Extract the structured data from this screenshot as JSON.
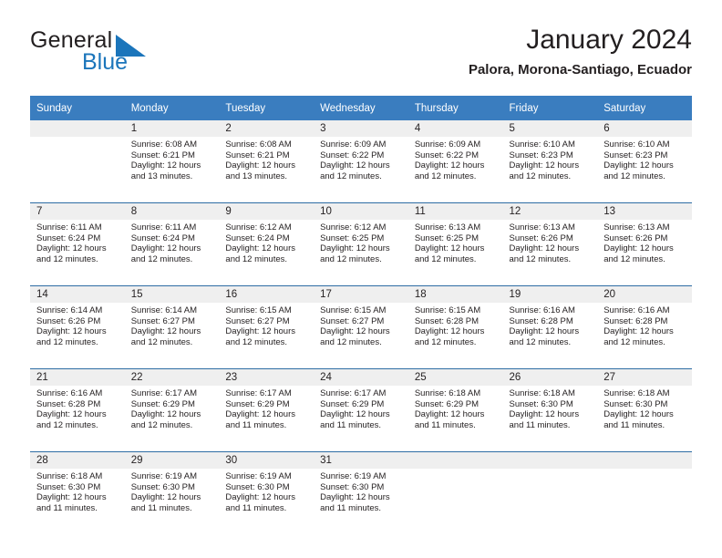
{
  "brand": {
    "name_part1": "General",
    "name_part2": "Blue",
    "accent_color": "#1b75bb",
    "triangle_icon": "logo-triangle-icon"
  },
  "header": {
    "month_title": "January 2024",
    "location": "Palora, Morona-Santiago, Ecuador"
  },
  "calendar": {
    "header_bg": "#3a7dbf",
    "row_divider_color": "#2e6da4",
    "daynum_band_bg": "#efefef",
    "weekday_headers": [
      "Sunday",
      "Monday",
      "Tuesday",
      "Wednesday",
      "Thursday",
      "Friday",
      "Saturday"
    ],
    "weeks": [
      [
        {
          "day": "",
          "sunrise": "",
          "sunset": "",
          "daylight1": "",
          "daylight2": ""
        },
        {
          "day": "1",
          "sunrise": "Sunrise: 6:08 AM",
          "sunset": "Sunset: 6:21 PM",
          "daylight1": "Daylight: 12 hours",
          "daylight2": "and 13 minutes."
        },
        {
          "day": "2",
          "sunrise": "Sunrise: 6:08 AM",
          "sunset": "Sunset: 6:21 PM",
          "daylight1": "Daylight: 12 hours",
          "daylight2": "and 13 minutes."
        },
        {
          "day": "3",
          "sunrise": "Sunrise: 6:09 AM",
          "sunset": "Sunset: 6:22 PM",
          "daylight1": "Daylight: 12 hours",
          "daylight2": "and 12 minutes."
        },
        {
          "day": "4",
          "sunrise": "Sunrise: 6:09 AM",
          "sunset": "Sunset: 6:22 PM",
          "daylight1": "Daylight: 12 hours",
          "daylight2": "and 12 minutes."
        },
        {
          "day": "5",
          "sunrise": "Sunrise: 6:10 AM",
          "sunset": "Sunset: 6:23 PM",
          "daylight1": "Daylight: 12 hours",
          "daylight2": "and 12 minutes."
        },
        {
          "day": "6",
          "sunrise": "Sunrise: 6:10 AM",
          "sunset": "Sunset: 6:23 PM",
          "daylight1": "Daylight: 12 hours",
          "daylight2": "and 12 minutes."
        }
      ],
      [
        {
          "day": "7",
          "sunrise": "Sunrise: 6:11 AM",
          "sunset": "Sunset: 6:24 PM",
          "daylight1": "Daylight: 12 hours",
          "daylight2": "and 12 minutes."
        },
        {
          "day": "8",
          "sunrise": "Sunrise: 6:11 AM",
          "sunset": "Sunset: 6:24 PM",
          "daylight1": "Daylight: 12 hours",
          "daylight2": "and 12 minutes."
        },
        {
          "day": "9",
          "sunrise": "Sunrise: 6:12 AM",
          "sunset": "Sunset: 6:24 PM",
          "daylight1": "Daylight: 12 hours",
          "daylight2": "and 12 minutes."
        },
        {
          "day": "10",
          "sunrise": "Sunrise: 6:12 AM",
          "sunset": "Sunset: 6:25 PM",
          "daylight1": "Daylight: 12 hours",
          "daylight2": "and 12 minutes."
        },
        {
          "day": "11",
          "sunrise": "Sunrise: 6:13 AM",
          "sunset": "Sunset: 6:25 PM",
          "daylight1": "Daylight: 12 hours",
          "daylight2": "and 12 minutes."
        },
        {
          "day": "12",
          "sunrise": "Sunrise: 6:13 AM",
          "sunset": "Sunset: 6:26 PM",
          "daylight1": "Daylight: 12 hours",
          "daylight2": "and 12 minutes."
        },
        {
          "day": "13",
          "sunrise": "Sunrise: 6:13 AM",
          "sunset": "Sunset: 6:26 PM",
          "daylight1": "Daylight: 12 hours",
          "daylight2": "and 12 minutes."
        }
      ],
      [
        {
          "day": "14",
          "sunrise": "Sunrise: 6:14 AM",
          "sunset": "Sunset: 6:26 PM",
          "daylight1": "Daylight: 12 hours",
          "daylight2": "and 12 minutes."
        },
        {
          "day": "15",
          "sunrise": "Sunrise: 6:14 AM",
          "sunset": "Sunset: 6:27 PM",
          "daylight1": "Daylight: 12 hours",
          "daylight2": "and 12 minutes."
        },
        {
          "day": "16",
          "sunrise": "Sunrise: 6:15 AM",
          "sunset": "Sunset: 6:27 PM",
          "daylight1": "Daylight: 12 hours",
          "daylight2": "and 12 minutes."
        },
        {
          "day": "17",
          "sunrise": "Sunrise: 6:15 AM",
          "sunset": "Sunset: 6:27 PM",
          "daylight1": "Daylight: 12 hours",
          "daylight2": "and 12 minutes."
        },
        {
          "day": "18",
          "sunrise": "Sunrise: 6:15 AM",
          "sunset": "Sunset: 6:28 PM",
          "daylight1": "Daylight: 12 hours",
          "daylight2": "and 12 minutes."
        },
        {
          "day": "19",
          "sunrise": "Sunrise: 6:16 AM",
          "sunset": "Sunset: 6:28 PM",
          "daylight1": "Daylight: 12 hours",
          "daylight2": "and 12 minutes."
        },
        {
          "day": "20",
          "sunrise": "Sunrise: 6:16 AM",
          "sunset": "Sunset: 6:28 PM",
          "daylight1": "Daylight: 12 hours",
          "daylight2": "and 12 minutes."
        }
      ],
      [
        {
          "day": "21",
          "sunrise": "Sunrise: 6:16 AM",
          "sunset": "Sunset: 6:28 PM",
          "daylight1": "Daylight: 12 hours",
          "daylight2": "and 12 minutes."
        },
        {
          "day": "22",
          "sunrise": "Sunrise: 6:17 AM",
          "sunset": "Sunset: 6:29 PM",
          "daylight1": "Daylight: 12 hours",
          "daylight2": "and 12 minutes."
        },
        {
          "day": "23",
          "sunrise": "Sunrise: 6:17 AM",
          "sunset": "Sunset: 6:29 PM",
          "daylight1": "Daylight: 12 hours",
          "daylight2": "and 11 minutes."
        },
        {
          "day": "24",
          "sunrise": "Sunrise: 6:17 AM",
          "sunset": "Sunset: 6:29 PM",
          "daylight1": "Daylight: 12 hours",
          "daylight2": "and 11 minutes."
        },
        {
          "day": "25",
          "sunrise": "Sunrise: 6:18 AM",
          "sunset": "Sunset: 6:29 PM",
          "daylight1": "Daylight: 12 hours",
          "daylight2": "and 11 minutes."
        },
        {
          "day": "26",
          "sunrise": "Sunrise: 6:18 AM",
          "sunset": "Sunset: 6:30 PM",
          "daylight1": "Daylight: 12 hours",
          "daylight2": "and 11 minutes."
        },
        {
          "day": "27",
          "sunrise": "Sunrise: 6:18 AM",
          "sunset": "Sunset: 6:30 PM",
          "daylight1": "Daylight: 12 hours",
          "daylight2": "and 11 minutes."
        }
      ],
      [
        {
          "day": "28",
          "sunrise": "Sunrise: 6:18 AM",
          "sunset": "Sunset: 6:30 PM",
          "daylight1": "Daylight: 12 hours",
          "daylight2": "and 11 minutes."
        },
        {
          "day": "29",
          "sunrise": "Sunrise: 6:19 AM",
          "sunset": "Sunset: 6:30 PM",
          "daylight1": "Daylight: 12 hours",
          "daylight2": "and 11 minutes."
        },
        {
          "day": "30",
          "sunrise": "Sunrise: 6:19 AM",
          "sunset": "Sunset: 6:30 PM",
          "daylight1": "Daylight: 12 hours",
          "daylight2": "and 11 minutes."
        },
        {
          "day": "31",
          "sunrise": "Sunrise: 6:19 AM",
          "sunset": "Sunset: 6:30 PM",
          "daylight1": "Daylight: 12 hours",
          "daylight2": "and 11 minutes."
        },
        {
          "day": "",
          "sunrise": "",
          "sunset": "",
          "daylight1": "",
          "daylight2": ""
        },
        {
          "day": "",
          "sunrise": "",
          "sunset": "",
          "daylight1": "",
          "daylight2": ""
        },
        {
          "day": "",
          "sunrise": "",
          "sunset": "",
          "daylight1": "",
          "daylight2": ""
        }
      ]
    ]
  }
}
